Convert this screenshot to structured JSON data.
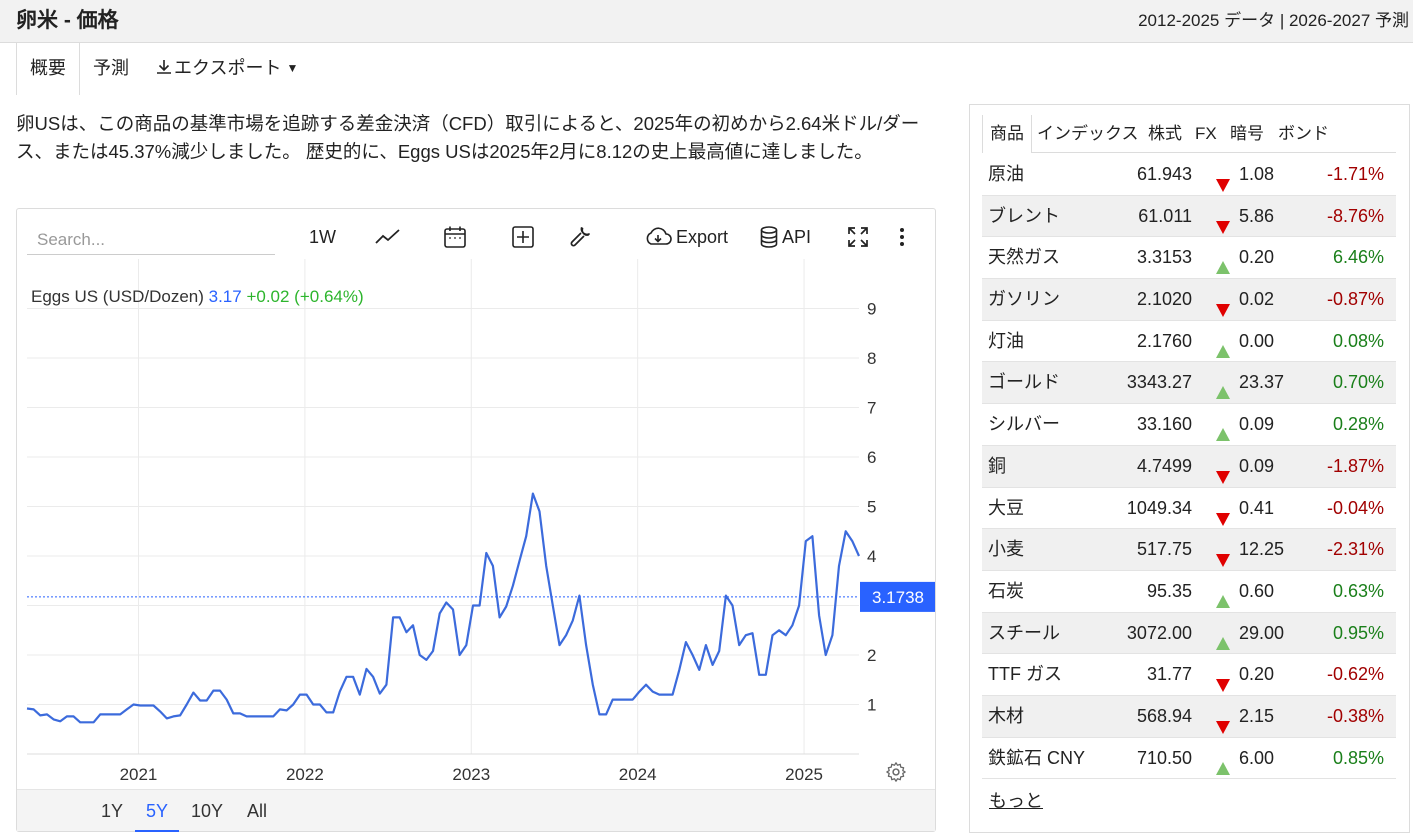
{
  "header": {
    "title": "卵米 - 価格",
    "data_range": "2012-2025 データ | 2026-2027 予測"
  },
  "tabs": [
    {
      "label": "概要"
    },
    {
      "label": "予測"
    },
    {
      "label": "エクスポート"
    }
  ],
  "description": "卵USは、この商品の基準市場を追跡する差金決済（CFD）取引によると、2025年の初めから2.64米ドル/ダース、または45.37%減少しました。 歴史的に、Eggs USは2025年2月に8.12の史上最高値に達しました。",
  "toolbar": {
    "search_placeholder": "Search...",
    "interval": "1W",
    "export_label": "Export",
    "api_label": "API"
  },
  "legend": {
    "name": "Eggs US (USD/Dozen)",
    "value": "3.17",
    "change": "+0.02 (+0.64%)"
  },
  "current_price_label": "3.1738",
  "ranges": [
    "1Y",
    "5Y",
    "10Y",
    "All"
  ],
  "active_range": "5Y",
  "colors": {
    "line": "#3c6bdc",
    "accent": "#2962ff",
    "up": "#1a7f1a",
    "down": "#a10000",
    "up_triangle": "#7cc26b",
    "down_triangle": "#e00000"
  },
  "chart_data": {
    "type": "line",
    "x_unit": "year",
    "y_unit": "USD/Dozen",
    "xlim": [
      2020.33,
      2025.33
    ],
    "ylim": [
      0,
      10
    ],
    "x_ticks": [
      2021,
      2022,
      2023,
      2024,
      2025
    ],
    "y_ticks": [
      1,
      2,
      3,
      4,
      5,
      6,
      7,
      8,
      9
    ],
    "grid": true,
    "legend_placement": "top-left",
    "series": [
      {
        "name": "Eggs US (USD/Dozen)",
        "points": [
          [
            2020.33,
            0.92
          ],
          [
            2020.37,
            0.9
          ],
          [
            2020.41,
            0.78
          ],
          [
            2020.45,
            0.8
          ],
          [
            2020.49,
            0.7
          ],
          [
            2020.53,
            0.66
          ],
          [
            2020.57,
            0.76
          ],
          [
            2020.61,
            0.76
          ],
          [
            2020.65,
            0.64
          ],
          [
            2020.69,
            0.64
          ],
          [
            2020.73,
            0.64
          ],
          [
            2020.77,
            0.8
          ],
          [
            2020.81,
            0.8
          ],
          [
            2020.85,
            0.8
          ],
          [
            2020.89,
            0.8
          ],
          [
            2020.93,
            0.9
          ],
          [
            2020.97,
            1.0
          ],
          [
            2021.01,
            0.98
          ],
          [
            2021.05,
            0.98
          ],
          [
            2021.09,
            0.98
          ],
          [
            2021.13,
            0.86
          ],
          [
            2021.17,
            0.72
          ],
          [
            2021.21,
            0.76
          ],
          [
            2021.25,
            0.78
          ],
          [
            2021.29,
            1.0
          ],
          [
            2021.33,
            1.24
          ],
          [
            2021.37,
            1.08
          ],
          [
            2021.41,
            1.08
          ],
          [
            2021.45,
            1.28
          ],
          [
            2021.49,
            1.28
          ],
          [
            2021.53,
            1.1
          ],
          [
            2021.57,
            0.82
          ],
          [
            2021.61,
            0.82
          ],
          [
            2021.65,
            0.76
          ],
          [
            2021.69,
            0.76
          ],
          [
            2021.73,
            0.76
          ],
          [
            2021.77,
            0.76
          ],
          [
            2021.81,
            0.76
          ],
          [
            2021.85,
            0.9
          ],
          [
            2021.89,
            0.88
          ],
          [
            2021.93,
            1.0
          ],
          [
            2021.97,
            1.2
          ],
          [
            2022.01,
            1.2
          ],
          [
            2022.05,
            1.0
          ],
          [
            2022.09,
            1.0
          ],
          [
            2022.13,
            0.84
          ],
          [
            2022.17,
            0.84
          ],
          [
            2022.21,
            1.26
          ],
          [
            2022.25,
            1.56
          ],
          [
            2022.29,
            1.56
          ],
          [
            2022.33,
            1.2
          ],
          [
            2022.37,
            1.72
          ],
          [
            2022.41,
            1.56
          ],
          [
            2022.45,
            1.22
          ],
          [
            2022.49,
            1.4
          ],
          [
            2022.53,
            2.76
          ],
          [
            2022.57,
            2.76
          ],
          [
            2022.61,
            2.46
          ],
          [
            2022.65,
            2.6
          ],
          [
            2022.69,
            2.0
          ],
          [
            2022.73,
            1.9
          ],
          [
            2022.77,
            2.08
          ],
          [
            2022.81,
            2.84
          ],
          [
            2022.85,
            3.06
          ],
          [
            2022.89,
            2.92
          ],
          [
            2022.93,
            2.0
          ],
          [
            2022.97,
            2.2
          ],
          [
            2023.01,
            3.0
          ],
          [
            2023.05,
            3.0
          ],
          [
            2023.09,
            4.06
          ],
          [
            2023.13,
            3.8
          ],
          [
            2023.17,
            2.76
          ],
          [
            2023.21,
            2.98
          ],
          [
            2023.25,
            3.4
          ],
          [
            2023.29,
            3.9
          ],
          [
            2023.33,
            4.4
          ],
          [
            2023.37,
            5.26
          ],
          [
            2023.41,
            4.9
          ],
          [
            2023.45,
            3.8
          ],
          [
            2023.49,
            3.0
          ],
          [
            2023.53,
            2.2
          ],
          [
            2023.57,
            2.4
          ],
          [
            2023.61,
            2.7
          ],
          [
            2023.65,
            3.2
          ],
          [
            2023.69,
            2.2
          ],
          [
            2023.73,
            1.4
          ],
          [
            2023.77,
            0.8
          ],
          [
            2023.81,
            0.8
          ],
          [
            2023.85,
            1.1
          ],
          [
            2023.89,
            1.1
          ],
          [
            2023.93,
            1.1
          ],
          [
            2023.97,
            1.1
          ],
          [
            2024.01,
            1.26
          ],
          [
            2024.05,
            1.4
          ],
          [
            2024.09,
            1.26
          ],
          [
            2024.13,
            1.2
          ],
          [
            2024.17,
            1.2
          ],
          [
            2024.21,
            1.2
          ],
          [
            2024.25,
            1.7
          ],
          [
            2024.29,
            2.26
          ],
          [
            2024.33,
            2.0
          ],
          [
            2024.37,
            1.7
          ],
          [
            2024.41,
            2.2
          ],
          [
            2024.45,
            1.8
          ],
          [
            2024.49,
            2.08
          ],
          [
            2024.53,
            3.2
          ],
          [
            2024.57,
            3.0
          ],
          [
            2024.61,
            2.2
          ],
          [
            2024.65,
            2.4
          ],
          [
            2024.69,
            2.44
          ],
          [
            2024.73,
            1.6
          ],
          [
            2024.77,
            1.6
          ],
          [
            2024.81,
            2.4
          ],
          [
            2024.85,
            2.5
          ],
          [
            2024.89,
            2.4
          ],
          [
            2024.93,
            2.6
          ],
          [
            2024.97,
            3.0
          ],
          [
            2025.01,
            4.3
          ],
          [
            2025.05,
            4.4
          ],
          [
            2025.09,
            2.8
          ],
          [
            2025.13,
            2.0
          ],
          [
            2025.17,
            2.4
          ],
          [
            2025.21,
            3.8
          ],
          [
            2025.25,
            4.5
          ],
          [
            2025.29,
            4.3
          ],
          [
            2025.33,
            4.0
          ]
        ]
      }
    ]
  },
  "sidebar": {
    "tabs": [
      "商品",
      "インデックス",
      "株式",
      "FX",
      "暗号",
      "ボンド"
    ],
    "rows": [
      {
        "name": "原油",
        "price": "61.943",
        "dir": "down",
        "change": "1.08",
        "pct": "-1.71%"
      },
      {
        "name": "ブレント",
        "price": "61.011",
        "dir": "down",
        "change": "5.86",
        "pct": "-8.76%"
      },
      {
        "name": "天然ガス",
        "price": "3.3153",
        "dir": "up",
        "change": "0.20",
        "pct": "6.46%"
      },
      {
        "name": "ガソリン",
        "price": "2.1020",
        "dir": "down",
        "change": "0.02",
        "pct": "-0.87%"
      },
      {
        "name": "灯油",
        "price": "2.1760",
        "dir": "up",
        "change": "0.00",
        "pct": "0.08%"
      },
      {
        "name": "ゴールド",
        "price": "3343.27",
        "dir": "up",
        "change": "23.37",
        "pct": "0.70%"
      },
      {
        "name": "シルバー",
        "price": "33.160",
        "dir": "up",
        "change": "0.09",
        "pct": "0.28%"
      },
      {
        "name": "銅",
        "price": "4.7499",
        "dir": "down",
        "change": "0.09",
        "pct": "-1.87%"
      },
      {
        "name": "大豆",
        "price": "1049.34",
        "dir": "down",
        "change": "0.41",
        "pct": "-0.04%"
      },
      {
        "name": "小麦",
        "price": "517.75",
        "dir": "down",
        "change": "12.25",
        "pct": "-2.31%"
      },
      {
        "name": "石炭",
        "price": "95.35",
        "dir": "up",
        "change": "0.60",
        "pct": "0.63%"
      },
      {
        "name": "スチール",
        "price": "3072.00",
        "dir": "up",
        "change": "29.00",
        "pct": "0.95%"
      },
      {
        "name": "TTF ガス",
        "price": "31.77",
        "dir": "down",
        "change": "0.20",
        "pct": "-0.62%"
      },
      {
        "name": "木材",
        "price": "568.94",
        "dir": "down",
        "change": "2.15",
        "pct": "-0.38%"
      },
      {
        "name": "鉄鉱石 CNY",
        "price": "710.50",
        "dir": "up",
        "change": "6.00",
        "pct": "0.85%"
      }
    ],
    "more_label": "もっと"
  }
}
